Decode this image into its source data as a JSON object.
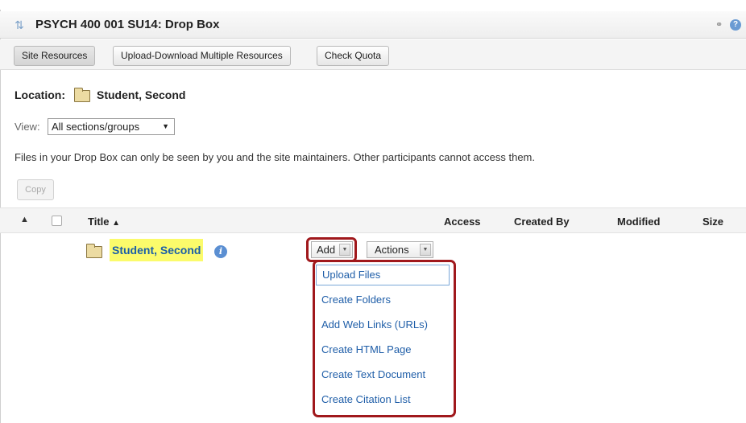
{
  "tool": {
    "title": "PSYCH 400 001 SU14: Drop Box",
    "icons": {
      "reset": "reset-icon",
      "link": "link-icon",
      "help": "help-icon"
    }
  },
  "toolbar": {
    "buttons": [
      "Site Resources",
      "Upload-Download Multiple Resources",
      "Check Quota"
    ]
  },
  "location": {
    "label": "Location:",
    "folder_icon": "folder-icon",
    "name": "Student, Second"
  },
  "view": {
    "label": "View:",
    "selected": "All sections/groups"
  },
  "notice": "Files in your Drop Box can only be seen by you and the site maintainers. Other participants cannot access them.",
  "copy_button": "Copy",
  "table": {
    "columns": [
      "Title",
      "Access",
      "Created By",
      "Modified",
      "Size"
    ],
    "rows": [
      {
        "name": "Student, Second",
        "add_label": "Add",
        "actions_label": "Actions"
      }
    ]
  },
  "add_menu": {
    "items": [
      "Upload Files",
      "Create Folders",
      "Add Web Links (URLs)",
      "Create HTML Page",
      "Create Text Document",
      "Create Citation List"
    ]
  },
  "colors": {
    "highlight_red": "#a0181c",
    "link_blue": "#1f5ea8",
    "name_highlight": "#fbfb6b"
  }
}
